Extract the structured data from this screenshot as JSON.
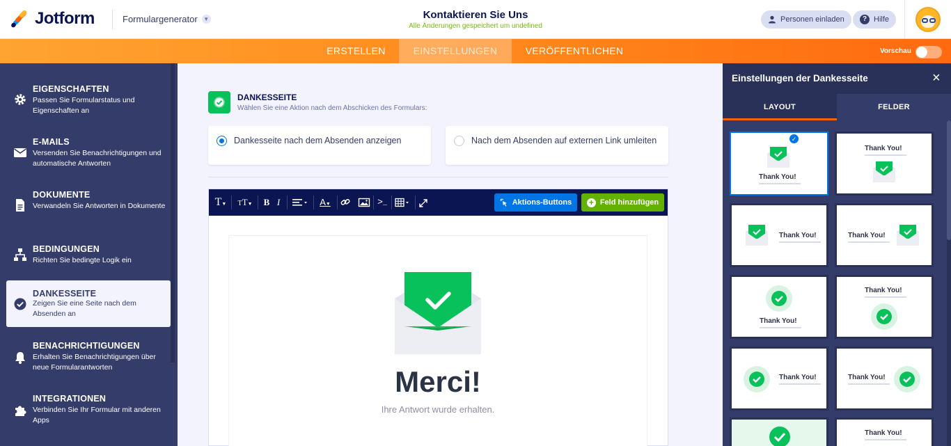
{
  "header": {
    "brand": "Jotform",
    "generator_label": "Formulargenerator",
    "form_title": "Kontaktieren Sie Uns",
    "save_status": "Alle Änderungen gespeichert um undefined",
    "invite_label": "Personen einladen",
    "help_label": "Hilfe"
  },
  "nav": {
    "tabs": [
      "ERSTELLEN",
      "EINSTELLUNGEN",
      "VERÖFFENTLICHEN"
    ],
    "active_tab": "EINSTELLUNGEN",
    "preview_label": "Vorschau"
  },
  "sidebar": {
    "items": [
      {
        "title": "EIGENSCHAFTEN",
        "desc": "Passen Sie Formularstatus und Eigenschaften an",
        "icon": "gear-icon"
      },
      {
        "title": "E-MAILS",
        "desc": "Versenden Sie Benachrichtigungen und automatische Antworten",
        "icon": "envelope-icon"
      },
      {
        "title": "DOKUMENTE",
        "desc": "Verwandeln Sie Antworten in Dokumente",
        "icon": "document-icon"
      },
      {
        "title": "BEDINGUNGEN",
        "desc": "Richten Sie bedingte Logik ein",
        "icon": "sitemap-icon"
      },
      {
        "title": "DANKESSEITE",
        "desc": "Zeigen Sie eine Seite nach dem Absenden an",
        "icon": "check-circle-icon"
      },
      {
        "title": "BENACHRICHTIGUNGEN",
        "desc": "Erhalten Sie Benachrichtigungen über neue Formularantworten",
        "icon": "bell-icon"
      },
      {
        "title": "INTEGRATIONEN",
        "desc": "Verbinden Sie Ihr Formular mit anderen Apps",
        "icon": "puzzle-icon"
      }
    ],
    "active_item": "DANKESSEITE"
  },
  "main": {
    "section_title": "DANKESSEITE",
    "section_subtitle": "Wählen Sie eine Aktion nach dem Abschicken des Formulars:",
    "options": [
      {
        "label": "Dankesseite nach dem Absenden anzeigen",
        "selected": true
      },
      {
        "label": "Nach dem Absenden auf externen Link umleiten",
        "selected": false
      }
    ],
    "toolbar": {
      "action_buttons_label": "Aktions-Buttons",
      "add_field_label": "Feld hinzufügen"
    },
    "thankyou": {
      "heading": "Merci!",
      "message": "Ihre Antwort wurde erhalten."
    }
  },
  "right_panel": {
    "title": "Einstellungen der Dankesseite",
    "tabs": [
      "LAYOUT",
      "FELDER"
    ],
    "active_tab": "LAYOUT",
    "template_text": "Thank You!",
    "accent_color": "#09c15a"
  }
}
